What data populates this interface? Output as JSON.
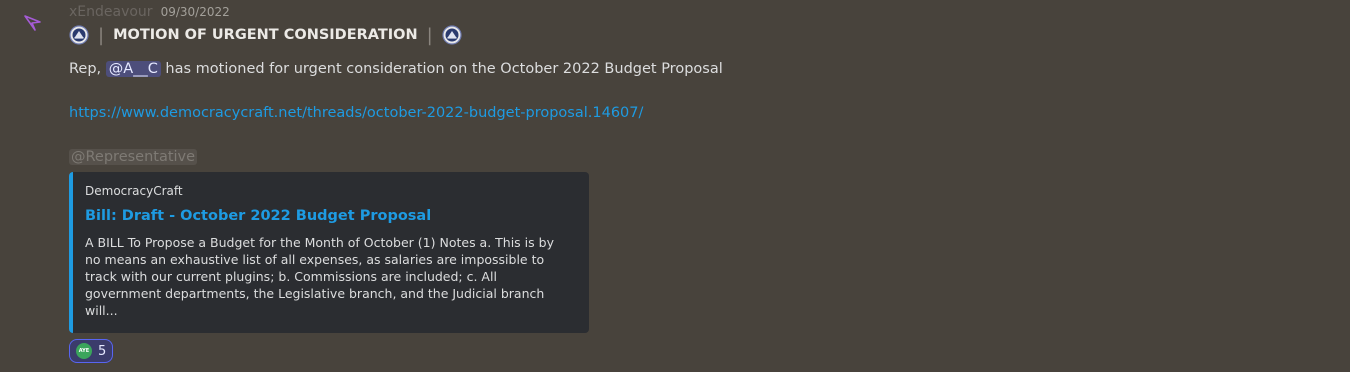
{
  "message": {
    "author": "xEndeavour",
    "timestamp": "09/30/2022",
    "title": "MOTION OF URGENT CONSIDERATION",
    "separator": "|",
    "line1_prefix": "Rep, ",
    "user_mention": "@A__C",
    "line1_suffix": " has motioned for urgent consideration on the October 2022 Budget Proposal",
    "link": "https://www.democracycraft.net/threads/october-2022-budget-proposal.14607/",
    "role_mention": "@Representative"
  },
  "embed": {
    "provider": "DemocracyCraft",
    "title": "Bill: Draft - October 2022 Budget Proposal",
    "description": "A BILL To Propose a Budget for the Month of October (1) Notes a. This is by no means an exhaustive list of all expenses, as salaries are impossible to track with our current plugins; b. Commissions are included; c. All government departments, the Legislative branch, and the Judicial branch will...",
    "accent_color": "#1e9be2"
  },
  "reactions": [
    {
      "emoji_label": "AYE",
      "count": "5"
    }
  ],
  "colors": {
    "background": "#48433c",
    "link": "#1e9be2",
    "embed_bg": "#2b2d31"
  }
}
